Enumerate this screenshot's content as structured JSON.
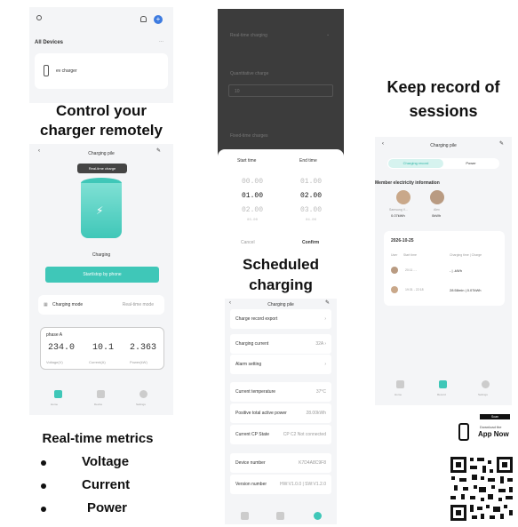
{
  "left": {
    "top_panel": {
      "title": "All Devices",
      "more": "...",
      "device_name": "ev charger"
    },
    "headline_1": "Control your",
    "headline_2": "charger remotely",
    "charging_panel": {
      "title": "Charging pile",
      "tooltip": "Real-time charge",
      "status": "Charging",
      "action_button": "Start/stop by phone",
      "mode_label": "Charging mode",
      "mode_value": "Real-time mode",
      "phase_label": "phase A",
      "metrics": [
        {
          "value": "234.0",
          "unit": "Voltage(V)"
        },
        {
          "value": "10.1",
          "unit": "Current(A)"
        },
        {
          "value": "2.363",
          "unit": "Power(kW)"
        }
      ],
      "nav": [
        "Home",
        "Device",
        "Settings"
      ]
    },
    "metrics_heading": "Real-time metrics",
    "bullets": [
      "Voltage",
      "Current",
      "Power"
    ]
  },
  "middle": {
    "top_panel": {
      "row1": "Real-time charging",
      "row2": "Quantitative charge",
      "row2_value": "10",
      "row3": "Fixed-time charges"
    },
    "picker": {
      "start_label": "Start time",
      "end_label": "End time",
      "start_times": [
        "00.00",
        "01.00",
        "02.00",
        "03.00"
      ],
      "end_times": [
        "01.00",
        "02.00",
        "03.00",
        "04.00"
      ],
      "cancel": "Cancel",
      "confirm": "Confirm"
    },
    "headline_1": "Scheduled",
    "headline_2": "charging",
    "settings_panel": {
      "title": "Charging pile",
      "rows": [
        {
          "label": "Charge record export",
          "value": "›"
        },
        {
          "label": "Charging current",
          "value": "32A ›"
        },
        {
          "label": "Alarm setting",
          "value": "›"
        },
        {
          "label": "Current temperature",
          "value": "37°C"
        },
        {
          "label": "Positive total active power",
          "value": "28.00kWh"
        },
        {
          "label": "Current CP State",
          "value": "CP C2 Not connected"
        },
        {
          "label": "Device number",
          "value": "K7D4A8C9F8"
        },
        {
          "label": "Version number",
          "value": "HW:V1.0.0 | SW:V1.2.0"
        }
      ]
    }
  },
  "right": {
    "headline_1": "Keep record of",
    "headline_2": "sessions",
    "session_panel": {
      "title": "Charging pile",
      "tab_active": "Charging record",
      "tab_inactive": "Power",
      "section_title": "Member electricity information",
      "members": [
        {
          "name": "Samsung V...",
          "energy": "0.07kWh"
        },
        {
          "name": "Alex",
          "energy": "0kWh"
        }
      ],
      "date": "2026-10-25",
      "columns": [
        "User",
        "Start time",
        "Charging time | Charge"
      ],
      "records": [
        {
          "start": "20:11 - -",
          "charge": "- | -kWh"
        },
        {
          "start": "19:31 - 22:18",
          "charge": "28:58min | 0.07kWh"
        }
      ],
      "nav": [
        "Home",
        "Record",
        "Settings"
      ]
    },
    "qr": {
      "small_label": "Scan",
      "download_line1": "Download the",
      "download_line2": "App Now"
    }
  },
  "colors": {
    "accent_teal": "#3fc7b8",
    "accent_teal_dark": "#2fb5a6",
    "dark_panel": "#3c3c3c",
    "background": "#f4f5f7",
    "accent_blue": "#3d7be0"
  }
}
